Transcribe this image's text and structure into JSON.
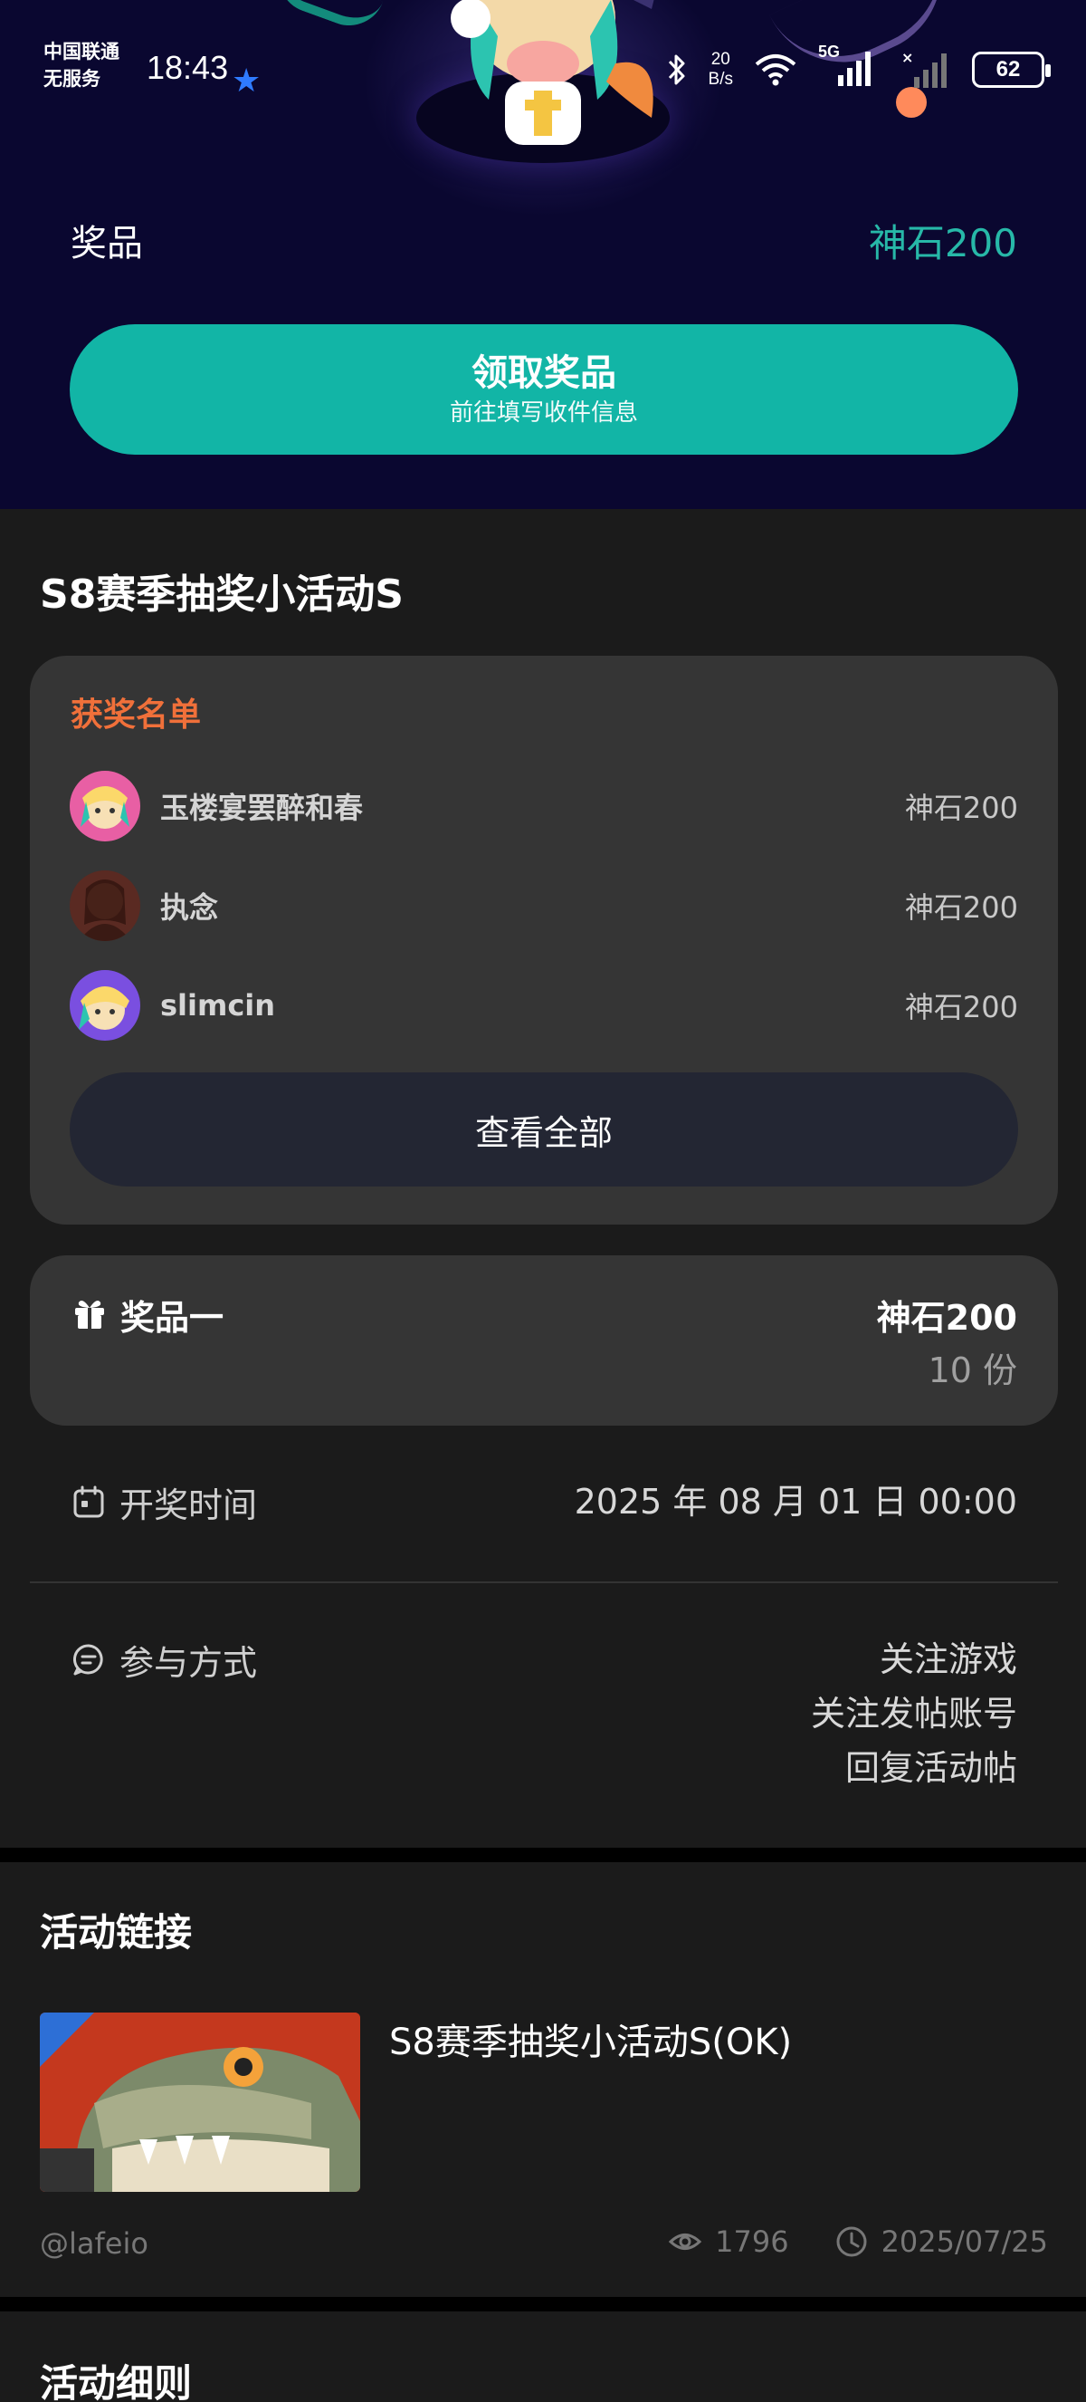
{
  "status_bar": {
    "carrier_line1": "中国联通",
    "carrier_line2": "无服务",
    "time": "18:43",
    "net_speed_value": "20",
    "net_speed_unit": "B/s",
    "network": "5G",
    "battery": "62"
  },
  "hero": {
    "prize_label": "奖品",
    "prize_value": "神石200",
    "claim_button": {
      "title": "领取奖品",
      "subtitle": "前往填写收件信息"
    }
  },
  "event": {
    "title": "S8赛季抽奖小活动S"
  },
  "winners": {
    "heading": "获奖名单",
    "items": [
      {
        "name": "玉楼宴罢醉和春",
        "prize": "神石200"
      },
      {
        "name": "执念",
        "prize": "神石200"
      },
      {
        "name": "slimcin",
        "prize": "神石200"
      }
    ],
    "view_all": "查看全部"
  },
  "prize_card": {
    "name": "奖品一",
    "amount": "神石200",
    "count": "10 份"
  },
  "draw_time": {
    "label": "开奖时间",
    "value": "2025 年 08 月 01 日 00:00"
  },
  "participation": {
    "label": "参与方式",
    "methods": [
      "关注游戏",
      "关注发帖账号",
      "回复活动帖"
    ]
  },
  "activity_link": {
    "heading": "活动链接",
    "title": "S8赛季抽奖小活动S(OK)",
    "author": "@lafeio",
    "views": "1796",
    "date": "2025/07/25"
  },
  "rules": {
    "heading": "活动细则"
  },
  "colors": {
    "accent": "#12b5a6",
    "winner_heading": "#f0703a",
    "hero_bg": "#0a0730",
    "card_bg": "#353535"
  }
}
